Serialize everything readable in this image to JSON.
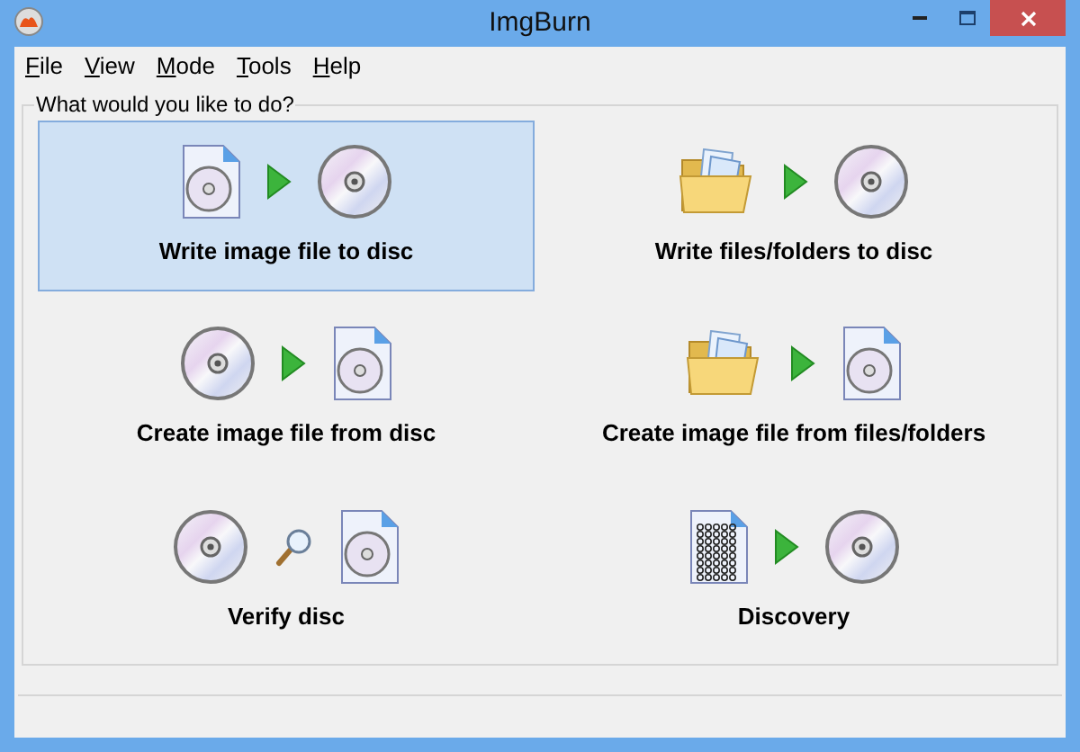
{
  "window": {
    "title": "ImgBurn"
  },
  "menu": [
    "File",
    "View",
    "Mode",
    "Tools",
    "Help"
  ],
  "group": {
    "title": "What would you like to do?"
  },
  "tiles": [
    {
      "label": "Write image file to disc",
      "kind": "write-image",
      "selected": true
    },
    {
      "label": "Write files/folders to disc",
      "kind": "write-files",
      "selected": false
    },
    {
      "label": "Create image file from disc",
      "kind": "read",
      "selected": false
    },
    {
      "label": "Create image file from files/folders",
      "kind": "build",
      "selected": false
    },
    {
      "label": "Verify disc",
      "kind": "verify",
      "selected": false
    },
    {
      "label": "Discovery",
      "kind": "discovery",
      "selected": false
    }
  ]
}
